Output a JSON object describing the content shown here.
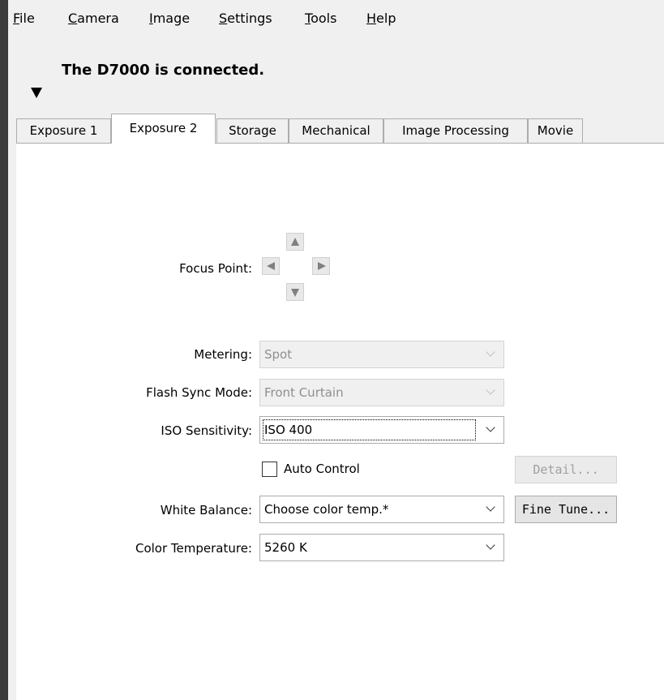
{
  "menu": [
    {
      "underline": "F",
      "rest": "ile"
    },
    {
      "underline": "C",
      "rest": "amera"
    },
    {
      "underline": "I",
      "rest": "mage"
    },
    {
      "underline": "S",
      "rest": "ettings"
    },
    {
      "underline": "T",
      "rest": "ools"
    },
    {
      "underline": "H",
      "rest": "elp"
    }
  ],
  "status": "The D7000 is connected.",
  "tabs": [
    "Exposure 1",
    "Exposure 2",
    "Storage",
    "Mechanical",
    "Image Processing",
    "Movie"
  ],
  "active_tab": "Exposure 2",
  "form": {
    "focus_point_label": "Focus Point:",
    "metering_label": "Metering:",
    "metering_value": "Spot",
    "flash_sync_label": "Flash Sync Mode:",
    "flash_sync_value": "Front Curtain",
    "iso_label": "ISO Sensitivity:",
    "iso_value": "ISO 400",
    "auto_control_label": "Auto Control",
    "detail_button": "Detail...",
    "white_balance_label": "White Balance:",
    "white_balance_value": "Choose color temp.*",
    "fine_tune_button": "Fine Tune...",
    "color_temp_label": "Color Temperature:",
    "color_temp_value": "5260 K"
  }
}
